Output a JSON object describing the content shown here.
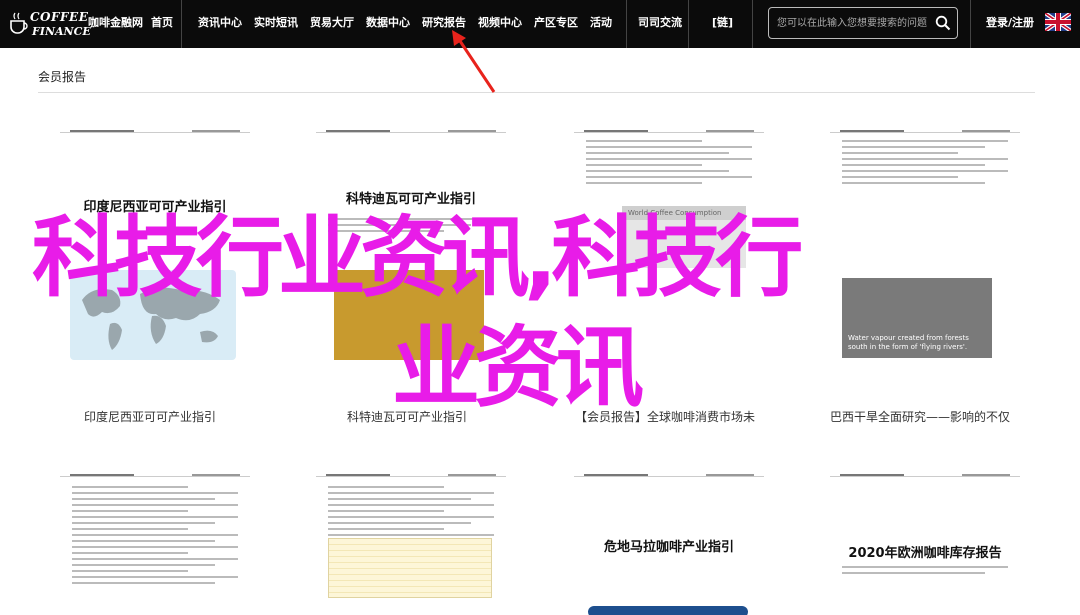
{
  "brand": {
    "logo_line1": "COFFEE",
    "logo_line2": "FINANCE"
  },
  "nav": {
    "items": [
      "咖啡金融网",
      "首页",
      "资讯中心",
      "实时短讯",
      "贸易大厅",
      "数据中心",
      "研究报告",
      "视频中心",
      "产区专区",
      "活动",
      "司司交流",
      "[链]",
      "登录/注册"
    ],
    "flag_icon": "uk-flag-icon"
  },
  "search": {
    "placeholder": "您可以在此输入您想要搜索的问题",
    "icon": "search-icon"
  },
  "section": {
    "title": "会员报告"
  },
  "cards": [
    {
      "doc_title": "印度尼西亚可可产业指引",
      "caption": "印度尼西亚可可产业指引"
    },
    {
      "doc_title": "科特迪瓦可可产业指引",
      "caption": "科特迪瓦可可产业指引"
    },
    {
      "doc_title": "",
      "caption": "【会员报告】全球咖啡消费市场未",
      "chart_label": "World Coffee Consumption"
    },
    {
      "doc_title": "",
      "caption": "巴西干旱全面研究——影响的不仅",
      "photo_caption_1": "Water vapour created from forests",
      "photo_caption_2": "south in the form of 'flying rivers'."
    },
    {
      "doc_title": ""
    },
    {
      "doc_title": ""
    },
    {
      "doc_title": "危地马拉咖啡产业指引"
    },
    {
      "doc_title": "2020年欧洲咖啡库存报告"
    }
  ],
  "overlay": {
    "line1": "科技行业资讯,科技行",
    "line2": "业资讯"
  },
  "colors": {
    "nav_bg": "#0b0b0b",
    "overlay_text": "#e81ce8",
    "arrow": "#e8231c"
  }
}
